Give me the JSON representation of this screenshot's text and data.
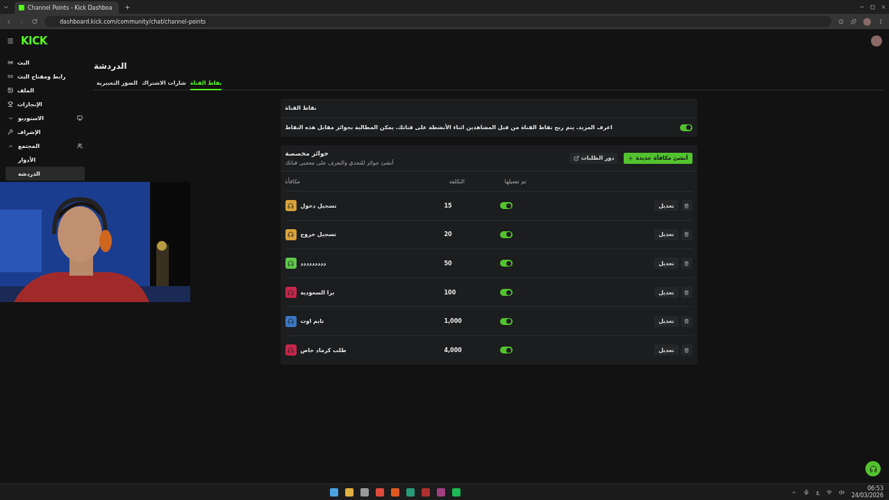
{
  "browser": {
    "tab_title": "Channel Points - Kick Dashboa",
    "url": "dashboard.kick.com/community/chat/channel-points"
  },
  "logo": "KICK",
  "sidebar": {
    "items": [
      {
        "label": "البث",
        "selected": false
      },
      {
        "label": "رابط ومفتاح البث",
        "selected": false
      },
      {
        "label": "الملف",
        "selected": false
      },
      {
        "label": "الإنجازات",
        "selected": false
      },
      {
        "label": "الاستوديو",
        "expanded": false,
        "selected": false
      },
      {
        "label": "الإشراف",
        "selected": false
      },
      {
        "label": "المجتمع",
        "expanded": true,
        "selected": false,
        "children": [
          {
            "label": "الأدوار",
            "selected": false
          },
          {
            "label": "الدردشة",
            "selected": true
          }
        ]
      }
    ]
  },
  "page_title": "الدردشة",
  "tabs": [
    {
      "label": "نقاط القناة",
      "selected": true
    },
    {
      "label": "شارات الاشتراك",
      "selected": false
    },
    {
      "label": "الصور التعبيرية",
      "selected": false
    }
  ],
  "channel_points": {
    "title": "نقاط القناة",
    "description": "اعرف المزيد. يتم ربح نقاط القناة من قبل المشاهدين اثناء الأنشطة على قناتك. يمكن المطالبة بجوائز مقابل هذه النقاط",
    "on": true
  },
  "rewards": {
    "title": "جوائز مخصصة",
    "subtitle": "أنشئ جوائز للتحدي والتعرف على معجبي قناتك",
    "queue_button": "دور الطلبات",
    "create_button": "أنشئ مكافأة جديدة",
    "columns": [
      "تم تفعيلها",
      "التكلفة",
      "مكافأة"
    ],
    "rows": [
      {
        "name": "تسجيل دخول",
        "color": "#d9a23a",
        "cost": "15",
        "enabled": true,
        "edit": "تعديل"
      },
      {
        "name": "تسجيل خروج",
        "color": "#d9a23a",
        "cost": "20",
        "enabled": true,
        "edit": "تعديل"
      },
      {
        "name": "ددددددددد",
        "color": "#5fc94a",
        "cost": "50",
        "enabled": true,
        "edit": "تعديل"
      },
      {
        "name": "برا السعودية",
        "color": "#c8264a",
        "cost": "100",
        "enabled": true,
        "edit": "تعديل"
      },
      {
        "name": "تايم اوت",
        "color": "#3b78c4",
        "cost": "1,000",
        "enabled": true,
        "edit": "تعديل"
      },
      {
        "name": "طلب كرماد خاص",
        "color": "#c8264a",
        "cost": "4,000",
        "enabled": true,
        "edit": "تعديل"
      }
    ]
  },
  "taskbar": {
    "lang": "ع",
    "time": "06:53",
    "date": "24/03/2026"
  }
}
